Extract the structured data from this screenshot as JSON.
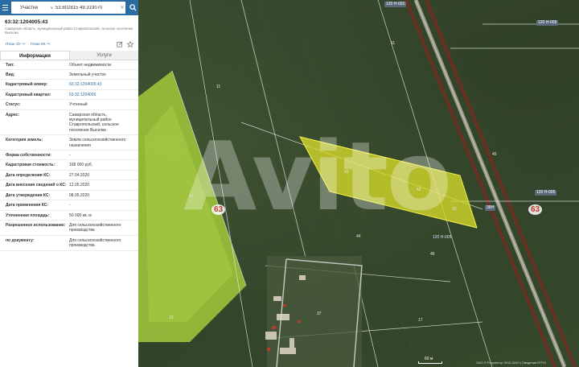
{
  "search": {
    "type_label": "Участки",
    "query": "53.602815 49.319070"
  },
  "object": {
    "number": "63:32:1204005:43",
    "address": "Самарская область, муниципальный район Ставропольский, сельское поселение Выселки",
    "plan_zu_link": "План ЗУ ⇒",
    "plan_kk_link": "План КК ⇒"
  },
  "tabs": [
    "Информация",
    "Услуги"
  ],
  "info_rows": [
    {
      "label": "Тип:",
      "value": "Объект недвижимости"
    },
    {
      "label": "Вид:",
      "value": "Земельный участок"
    },
    {
      "label": "Кадастровый номер:",
      "value": "63:32:1204005:43"
    },
    {
      "label": "Кадастровый квартал:",
      "value": "63:32:1204005"
    },
    {
      "label": "Статус:",
      "value": "Учтенный"
    },
    {
      "label": "Адрес:",
      "value": "Самарская область, муниципальный район Ставропольский, сельское поселение Выселки"
    },
    {
      "label": "Категория земель:",
      "value": "Земли сельскохозяйственного назначения"
    },
    {
      "label": "Форма собственности:",
      "value": "-"
    },
    {
      "label": "Кадастровая стоимость:",
      "value": "168 000 руб."
    },
    {
      "label": "Дата определения КС:",
      "value": "27.04.2020"
    },
    {
      "label": "Дата внесения сведений о КС:",
      "value": "12.05.2020"
    },
    {
      "label": "Дата утверждения КС:",
      "value": "08.05.2020"
    },
    {
      "label": "Дата применения КС:",
      "value": "-"
    },
    {
      "label": "Уточненная площадь:",
      "value": "50 000 кв. м"
    },
    {
      "label": "Разрешенное использование:",
      "value": "Для сельскохозяйственного производства"
    },
    {
      "label": "по документу:",
      "value": "Для сельскохозяйственного производства"
    }
  ],
  "map": {
    "watermark": "Avito",
    "region_labels": [
      "63",
      "63"
    ],
    "road_labels": [
      "120 Н-002",
      "120 Н-005",
      "36Н",
      "120 Н-005"
    ],
    "parcel_labels": [
      "11",
      "11",
      "41",
      "43",
      "42",
      "44",
      "45",
      "32",
      "46",
      "37",
      "17",
      "13"
    ],
    "distance_labels": [
      "120 Н-005"
    ],
    "scale_label": "60 м",
    "copyright": "ОАО © Росреестр 2010-2020 | Сведения ЕГРН"
  },
  "colors": {
    "header": "#2b6ca3",
    "link": "#2b6ca3",
    "highlight_parcel": "#d7dc2a",
    "field": "#9bc23a"
  }
}
